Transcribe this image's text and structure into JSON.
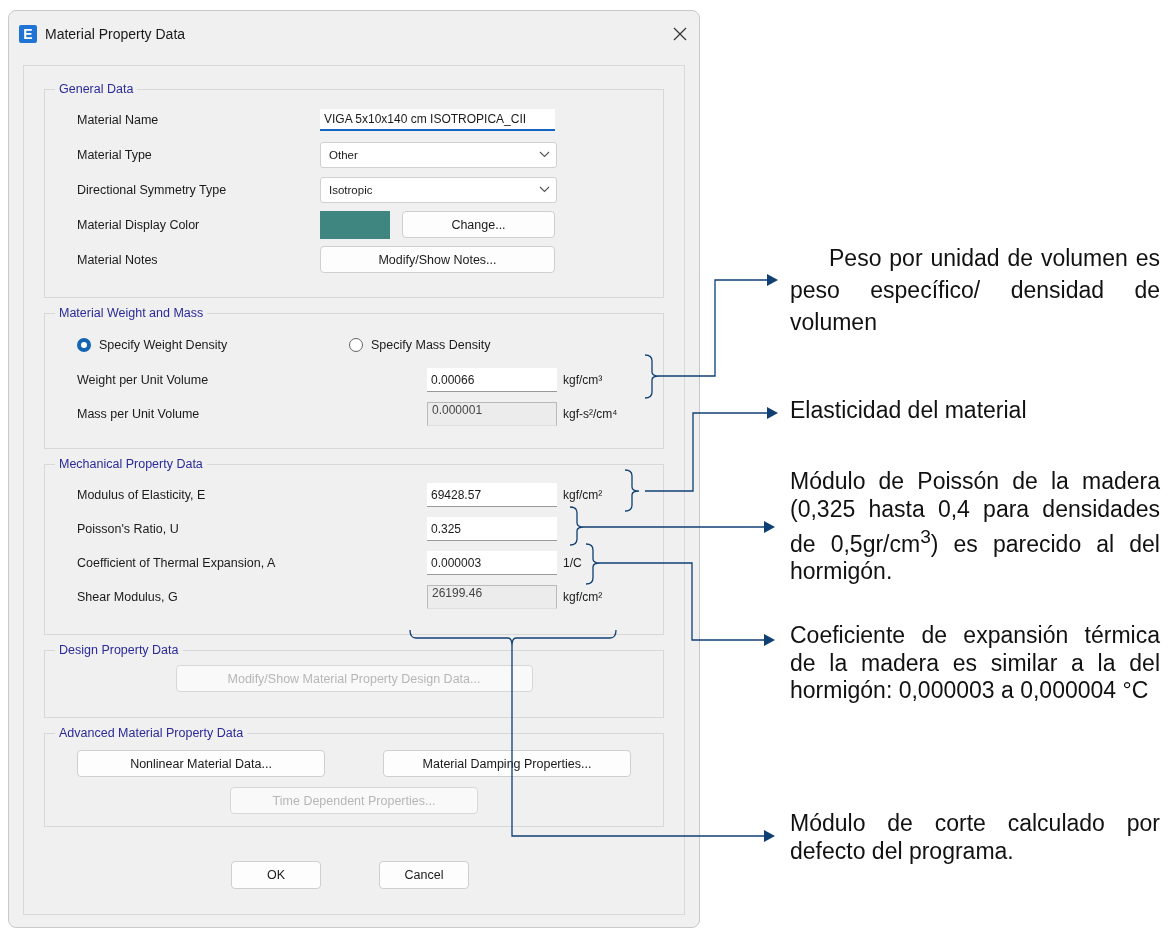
{
  "window": {
    "app_icon": "E",
    "title": "Material Property Data"
  },
  "general_data": {
    "title": "General Data",
    "rows": [
      {
        "kind": "text",
        "label": "Material Name",
        "value": "VIGA 5x10x140 cm ISOTROPICA_CII"
      },
      {
        "kind": "dropdown",
        "label": "Material Type",
        "value": "Other"
      },
      {
        "kind": "dropdown",
        "label": "Directional Symmetry Type",
        "value": "Isotropic"
      },
      {
        "kind": "color",
        "label": "Material Display Color",
        "color": "#3f8580",
        "button": "Change..."
      },
      {
        "kind": "button",
        "label": "Material Notes",
        "button": "Modify/Show Notes..."
      }
    ]
  },
  "weight_and_mass": {
    "title": "Material Weight and Mass",
    "options": [
      {
        "label": "Specify Weight Density",
        "selected": true
      },
      {
        "label": "Specify Mass Density",
        "selected": false
      }
    ],
    "rows": [
      {
        "label": "Weight per Unit Volume",
        "value": "0.00066",
        "unit": "kgf/cm³",
        "disabled": false
      },
      {
        "label": "Mass per Unit Volume",
        "value": "0.000001",
        "unit": "kgf-s²/cm⁴",
        "disabled": true
      }
    ]
  },
  "mechanical_property_data": {
    "title": "Mechanical Property Data",
    "rows": [
      {
        "label": "Modulus of Elasticity,  E",
        "value": "69428.57",
        "unit": "kgf/cm²",
        "disabled": false
      },
      {
        "label": "Poisson's Ratio,  U",
        "value": "0.325",
        "disabled": false
      },
      {
        "label": "Coefficient of Thermal Expansion,  A",
        "value": "0.000003",
        "unit": "1/C",
        "disabled": false
      },
      {
        "label": "Shear Modulus,  G",
        "value": "26199.46",
        "unit": "kgf/cm²",
        "disabled": true
      }
    ]
  },
  "design_property_data": {
    "title": "Design Property Data",
    "buttons": [
      {
        "label": "Modify/Show Material Property Design Data...",
        "disabled": true
      }
    ]
  },
  "advanced_material_property_data": {
    "title": "Advanced Material Property Data",
    "buttons": [
      {
        "label": "Nonlinear Material Data...",
        "disabled": false
      },
      {
        "label": "Material Damping Properties...",
        "disabled": false
      },
      {
        "label": "Time Dependent Properties...",
        "disabled": true
      }
    ]
  },
  "buttons": [
    "OK",
    "Cancel"
  ],
  "annotations": [
    {
      "text": "Peso por unidad de volumen es peso específico/ densidad de volumen"
    },
    {
      "text": "Elasticidad del material"
    },
    {
      "text": "Módulo de Poissón de la madera (0,325 hasta 0,4 para densidades de 0,5gr/cm$^{3}$) es parecido al del hormigón."
    },
    {
      "text": "Coeficiente de expansión térmica de la madera es similar a la del hormigón: 0,000003 a 0,000004 °C"
    },
    {
      "text": "Módulo de corte calculado por defecto del programa."
    }
  ]
}
